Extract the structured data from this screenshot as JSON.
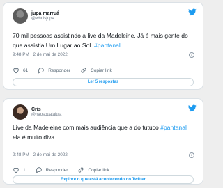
{
  "tweets": [
    {
      "display_name": "jupa marruá",
      "handle": "@whoisjupa",
      "text_main": "70 mil pessoas assistindo a live da Madeleine. Já é mais gente do que assistia Um Lugar ao Sol. ",
      "hashtag": "#pantanal",
      "text_after": "",
      "timestamp": "9:48 PM · 2 de mai de 2022",
      "like_count": "61",
      "reply_label": "Responder",
      "copy_label": "Copiar link",
      "button_label": "Ler 5 respostas"
    },
    {
      "display_name": "Cris",
      "handle": "@naosouatalula",
      "text_main": "Live da Madeleine com mais audiência que a do tutuco ",
      "hashtag": "#pantanal",
      "text_after": " ela é muito diva",
      "timestamp": "9:48 PM · 2 de mai de 2022",
      "like_count": "1",
      "reply_label": "Responder",
      "copy_label": "Copiar link",
      "button_label": "Explore o que está acontecendo no Twitter"
    }
  ],
  "colors": {
    "accent": "#1d9bf0",
    "like_icon": "#536471",
    "muted_text": "#6b7785"
  },
  "icons": [
    "twitter-bird-icon",
    "info-icon",
    "heart-icon",
    "reply-bubble-icon",
    "link-icon"
  ]
}
